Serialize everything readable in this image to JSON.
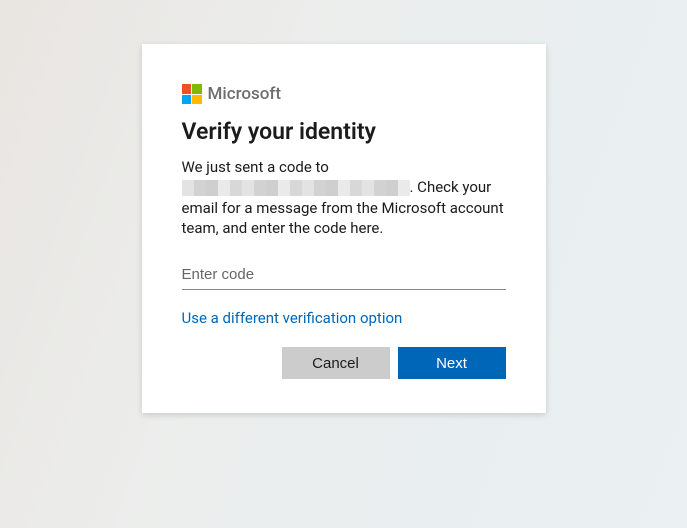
{
  "brand": "Microsoft",
  "title": "Verify your identity",
  "body": {
    "line1": "We just sent a code to",
    "line2_after_redaction": ". Check your email for a message from the Microsoft account team, and enter the code here."
  },
  "code_input": {
    "placeholder": "Enter code",
    "value": ""
  },
  "alt_link": "Use a different verification option",
  "buttons": {
    "cancel": "Cancel",
    "next": "Next"
  }
}
